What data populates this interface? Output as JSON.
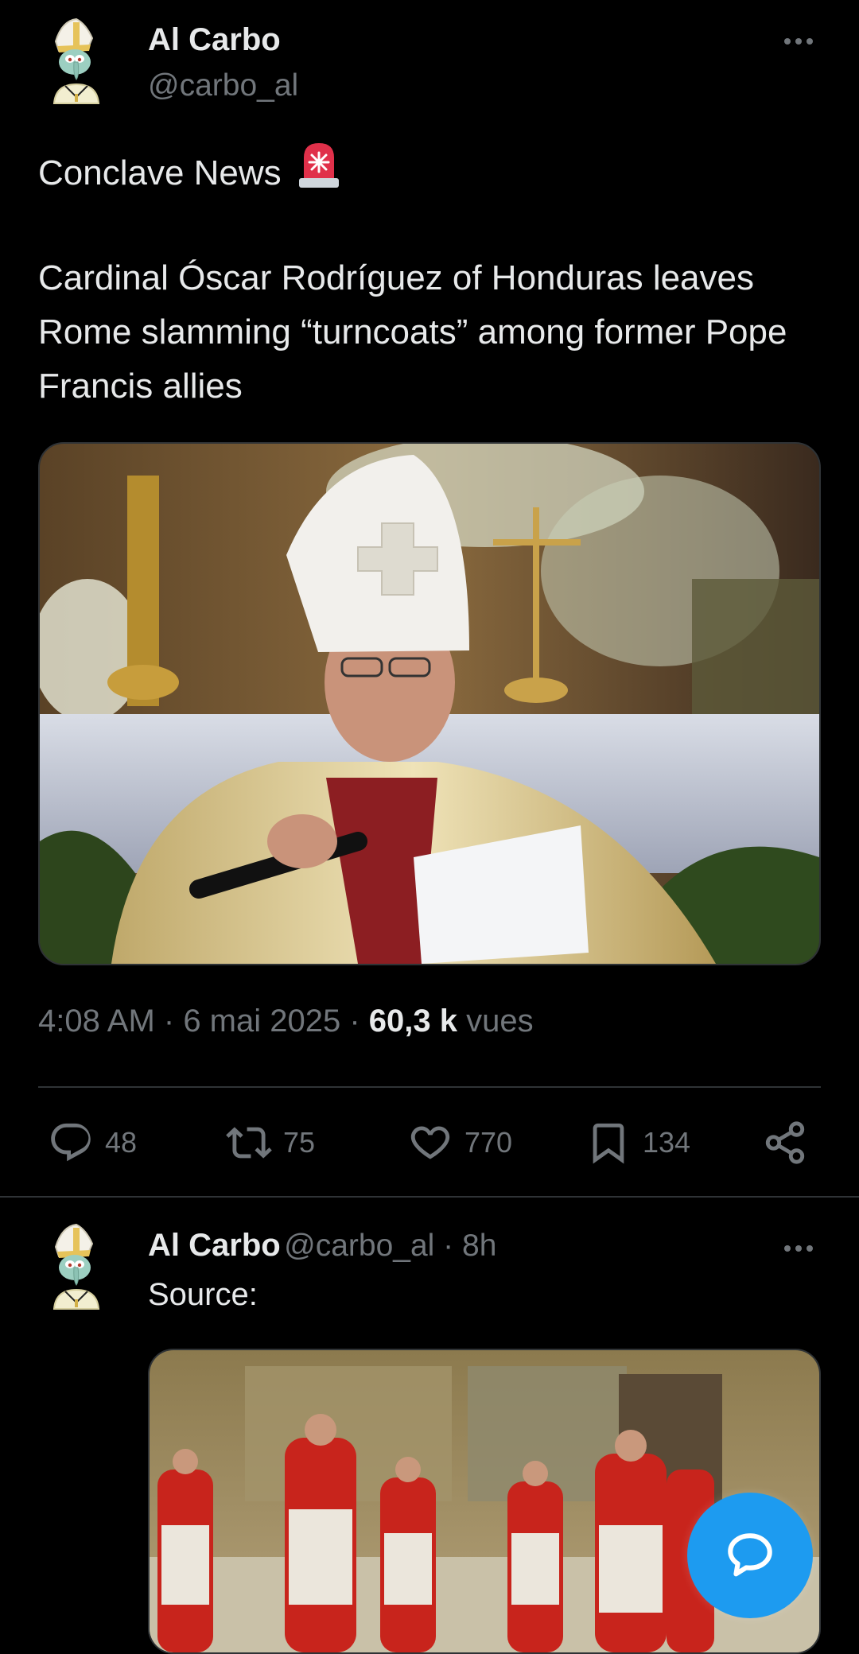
{
  "main_tweet": {
    "author_name": "Al Carbo",
    "author_handle": "@carbo_al",
    "headline": "Conclave News",
    "headline_emoji": "🚨",
    "body": "Cardinal Óscar Rodríguez of Honduras leaves Rome slamming “turncoats” among former Pope Francis allies",
    "time": "4:08 AM",
    "sep1": " · ",
    "date": "6 mai 2025",
    "sep2": " · ",
    "views_count": "60,3 k",
    "views_label": "vues"
  },
  "actions": {
    "replies": "48",
    "reposts": "75",
    "likes": "770",
    "bookmarks": "134"
  },
  "reply_tweet": {
    "author_name": "Al Carbo",
    "author_handle": "@carbo_al",
    "sep": " · ",
    "time_ago": "8h",
    "text": "Source:"
  },
  "icons": {
    "more": "more-horizontal-icon",
    "reply": "reply-bubble-icon",
    "repost": "repost-icon",
    "like": "heart-icon",
    "bookmark": "bookmark-icon",
    "share": "share-icon",
    "compose": "compose-reply-icon"
  },
  "colors": {
    "background": "#000000",
    "text": "#e7e9ea",
    "muted": "#71767b",
    "divider": "#2f3336",
    "accent": "#1d9bf0"
  }
}
